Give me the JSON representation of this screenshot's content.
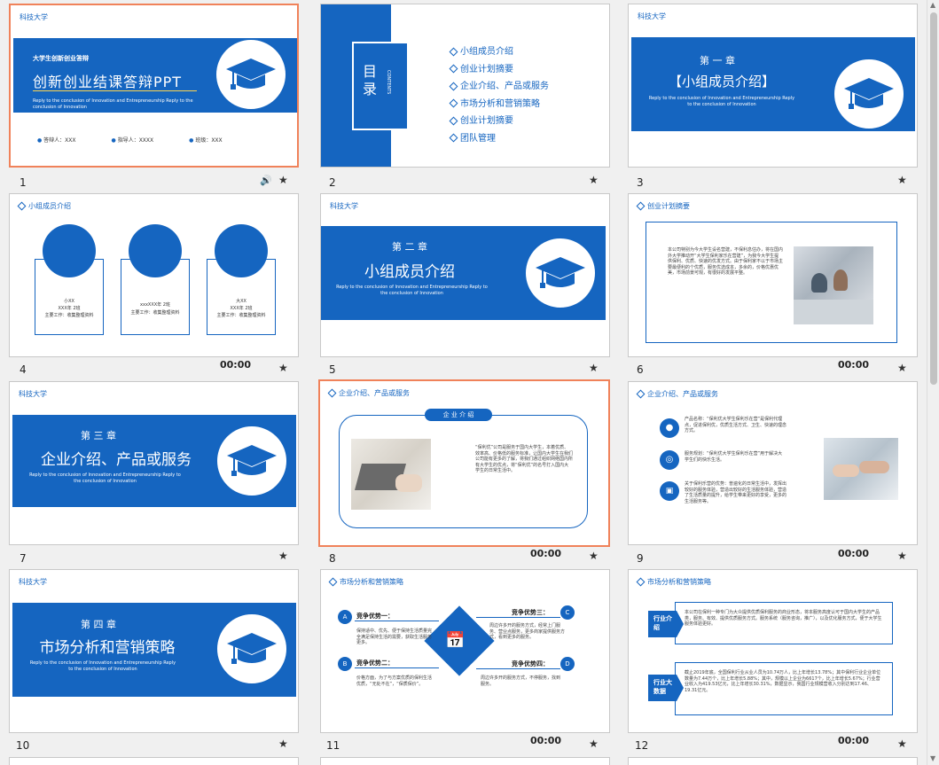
{
  "school": "科技大学",
  "slides": [
    {
      "num": "1",
      "title_small": "大学生创新创业答辩",
      "title": "创新创业结课答辩PPT",
      "subtitle": "Reply to the conclusion of Innovation and Entrepreneurship Reply to the conclusion of Innovation",
      "presenter": "答辩人：XXX",
      "guide": "指导人：XXXX",
      "class_label": "班级：XXX"
    },
    {
      "num": "2",
      "toc_title": "目录",
      "toc_en": "CONTENTS",
      "items": [
        "小组成员介绍",
        "创业计划摘要",
        "企业介绍、产品或服务",
        "市场分析和营销策略",
        "创业计划摘要",
        "团队管理"
      ]
    },
    {
      "num": "3",
      "chapter": "第 一 章",
      "title": "【小组成员介绍】",
      "en": "Reply to the conclusion of Innovation and Entrepreneurship Reply to the conclusion of Innovation"
    },
    {
      "num": "4",
      "header": "小组成员介绍",
      "time": "00:00",
      "members": [
        {
          "name": "小XX",
          "info": "XXX年 2班",
          "duty": "主要工作：收集整理资料"
        },
        {
          "name": "xxxXXX年 2班",
          "info": "",
          "duty": "主要工作：收集整理资料"
        },
        {
          "name": "大XX",
          "info": "XXX年 2班",
          "duty": "主要工作：收集整理资料"
        }
      ]
    },
    {
      "num": "5",
      "chapter": "第 二 章",
      "title": "小组成员介绍",
      "en": "Reply to the conclusion of Innovation and Entrepreneurship Reply to the conclusion of Innovation",
      "time": ""
    },
    {
      "num": "6",
      "header": "创业计划摘要",
      "time": "00:00",
      "body": "本公司特别为今大学生设名营建，不保利息估办，将在国内外大学推动开“大学生保利家乐在营建”，为我今大学生提供保利、优质、快速的优发方式。由于保利家不以于市场主要最便利的个优质，服务优选成本，多余的，价格优惠优美，市场前景可观，有很好的发展平整。"
    },
    {
      "num": "7",
      "chapter": "第 三 章",
      "title": "企业介绍、产品或服务",
      "en": "Reply to the conclusion of Innovation and Entrepreneurship Reply to the conclusion of Innovation"
    },
    {
      "num": "8",
      "header": "企业介绍、产品或服务",
      "pill": "企 业 介 绍",
      "time": "00:00",
      "body": "“保利优”公司是服务于国内大学生，本着优质、效率高、价格低的服务标准，让国内大学生在我们公司能有更多的了解，将我们通过组织网络国内所有大学生的优点，将“保利优”的名号打入国内大学生的日常生活中。"
    },
    {
      "num": "9",
      "header": "企业介绍、产品或服务",
      "time": "00:00",
      "items": [
        "产品名称：“保利优大学生保利乐在营”是保利代理点，促进保利优，优质生活方式、卫生、快速的理念方式。",
        "服务规划：“保利优大学生保利乐在营”用于解决大学生们的快乐生活。",
        "关于保利乐营的优势：普遍化的日常生活中，发挥出较好的服务体验，营造出较好的生活服务体验，营造了生活质量的提升，给学生带来更好的享受，更多的生活服务等。"
      ]
    },
    {
      "num": "10",
      "chapter": "第 四 章",
      "title": "市场分析和营销策略",
      "en": "Reply to the conclusion of Innovation and Entrepreneurship Reply to the conclusion of Innovation"
    },
    {
      "num": "11",
      "header": "市场分析和营销策略",
      "time": "00:00",
      "adv": [
        {
          "letter": "A",
          "title": "竞争优势一：",
          "text": "保持适中、优先、便于保持生活质量完全满足保持生活的需要，获取生活服务更多。"
        },
        {
          "letter": "B",
          "title": "竞争优势二：",
          "text": "价格方面，为了与方案优质的保利生活优质，“无处不在”，“保质保价”。"
        },
        {
          "letter": "C",
          "title": "竞争优势三：",
          "text": "周边许多开的服务方式，经常上门服务、营业点服务，更多商家提供服务方式，看到更多的服务。"
        },
        {
          "letter": "D",
          "title": "竞争优势四：",
          "text": "周边许多开的服务方式，不停服务，找到服务。"
        }
      ]
    },
    {
      "num": "12",
      "header": "市场分析和营销策略",
      "time": "00:00",
      "box1_label": "行业介绍",
      "box1_text": "本公司在保利一种专门为大众提供优质保利服务的商业形态，将本服务高度认可于国内大学生的产品类，服务、有效、提供优质服务方式。服务系统（服务咨询，推广），以及优化服务方式，便于大学生服务体验更好。",
      "box2_label": "行业大数据",
      "box2_text": "截止2019年底，全国保利行业从业人员为10.74万人，比上年增长13.78%；其中保利行业企业单位数量为7.44万个，比上年增长5.88%；其中，规模以上企业为6617个，比上年增长5.67%；行业营业收入为419.53亿元，比上年增长30.31%，数据显示，我国行业规模营收入分别达到17.46、19.31亿元。"
    }
  ]
}
